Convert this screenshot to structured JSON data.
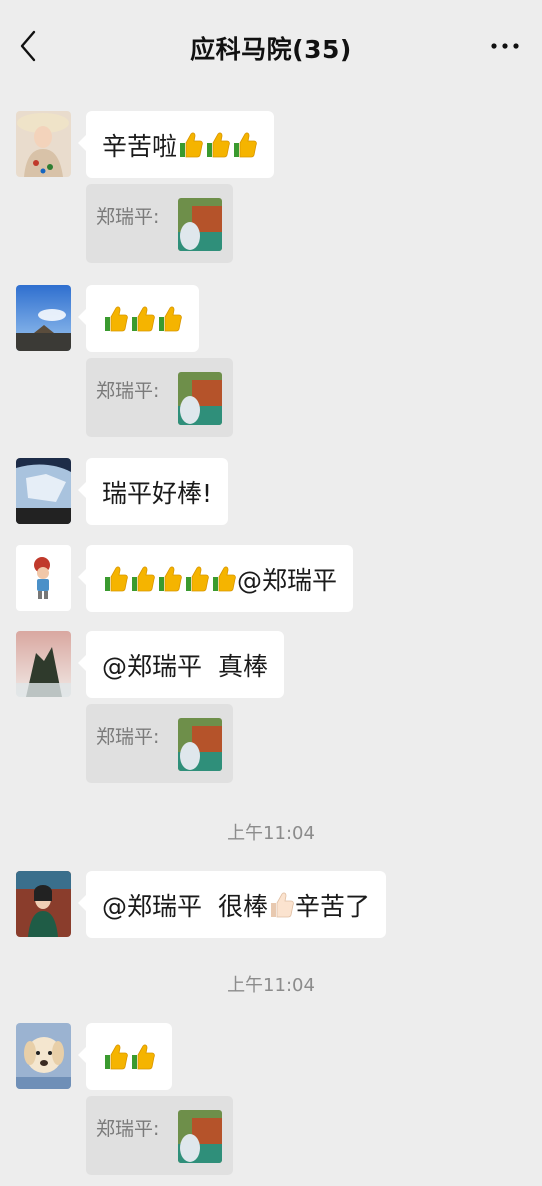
{
  "header": {
    "title": "应科马院(35)"
  },
  "timestamps": [
    "上午11:04",
    "上午11:04"
  ],
  "quote_label": "郑瑞平:",
  "messages": [
    {
      "text": "辛苦啦",
      "thumbs": 3
    },
    {
      "text": "",
      "thumbs": 3
    },
    {
      "text": "瑞平好棒!"
    },
    {
      "text": "@郑瑞平",
      "thumbs": 5
    },
    {
      "part1": "@郑瑞平",
      "part2": "真棒"
    },
    {
      "part1": "@郑瑞平",
      "part2": "很棒",
      "part3": "辛苦了"
    },
    {
      "text": "",
      "thumbs": 2
    }
  ],
  "icons": {
    "back": "chevron-left-icon",
    "more": "more-dots-icon",
    "thumbs": "thumbs-up-emoji",
    "thumb_light": "thumbs-up-light-emoji"
  },
  "colors": {
    "background": "#ededed",
    "bubble": "#ffffff",
    "quote": "#e0e0e0",
    "timestamp": "#8c8c8c"
  }
}
